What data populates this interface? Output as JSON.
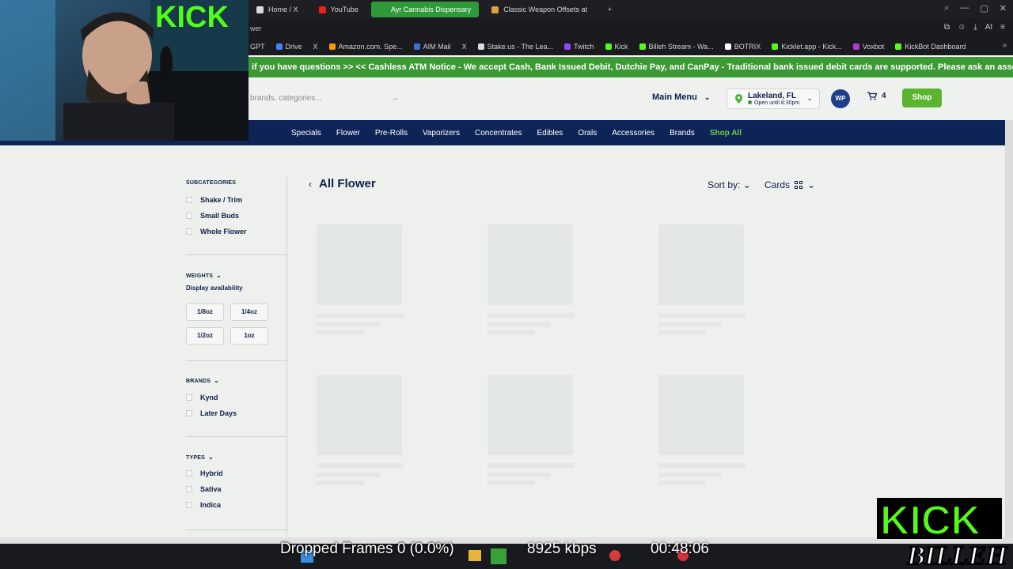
{
  "browser": {
    "tabs": [
      {
        "label": "Home / X",
        "color": "#dcdcdc",
        "active": false
      },
      {
        "label": "YouTube",
        "color": "#e62117",
        "active": false
      },
      {
        "label": "Ayr Cannabis Dispensary",
        "color": "#2f9a3a",
        "active": true
      },
      {
        "label": "Classic Weapon Offsets at",
        "color": "#d9a441",
        "active": false
      }
    ],
    "new_tab": "+",
    "url_fragment": "wer",
    "bookmarks": [
      {
        "label": "GPT",
        "color": ""
      },
      {
        "label": "Drive",
        "color": "#4285f4"
      },
      {
        "label": "X",
        "color": ""
      },
      {
        "label": "Amazon.com. Spe...",
        "color": "#ff9900"
      },
      {
        "label": "AIM Mail",
        "color": "#3a6fd8"
      },
      {
        "label": "X",
        "color": ""
      },
      {
        "label": "Stake.us - The Lea...",
        "color": "#dddddd"
      },
      {
        "label": "Twitch",
        "color": "#9146ff"
      },
      {
        "label": "Kick",
        "color": "#53fc18"
      },
      {
        "label": "Billeh Stream - Wa...",
        "color": "#53fc18"
      },
      {
        "label": "BOTRIX",
        "color": "#ffffff"
      },
      {
        "label": "Kicklet.app - Kick...",
        "color": "#53fc18"
      },
      {
        "label": "Voxbot",
        "color": "#b03bd6"
      },
      {
        "label": "KickBot Dashboard",
        "color": "#53fc18"
      }
    ],
    "toolbar_ai": "AI"
  },
  "site": {
    "ticker": "if you have questions >> << Cashless ATM Notice - We accept Cash, Bank Issued Debit, Dutchie Pay, and CanPay - Traditional bank issued debit cards are supported. Please ask an associate if you have qu",
    "search_placeholder": "brands, categories...",
    "main_menu": "Main Menu",
    "location": {
      "city": "Lakeland, FL",
      "hours": "Open until 8:30pm"
    },
    "avatar": "WP",
    "cart_count": "4",
    "shop_button": "Shop",
    "categories": [
      "Specials",
      "Flower",
      "Pre-Rolls",
      "Vaporizers",
      "Concentrates",
      "Edibles",
      "Orals",
      "Accessories",
      "Brands",
      "Shop All"
    ],
    "highlight_category": "Shop All",
    "colors": {
      "brand_green": "#3c9a35",
      "nav_blue": "#0e2456",
      "shop_green": "#5ab42f"
    }
  },
  "filters": {
    "subcategories_title": "SUBCATEGORIES",
    "subcategories": [
      "Shake / Trim",
      "Small Buds",
      "Whole Flower"
    ],
    "weights_title": "WEIGHTS",
    "display_availability": "Display availability",
    "weights": [
      "1/8oz",
      "1/4oz",
      "1/2oz",
      "1oz"
    ],
    "brands_title": "BRANDS",
    "brands": [
      "Kynd",
      "Later Days"
    ],
    "types_title": "TYPES",
    "types": [
      "Hybrid",
      "Sativa",
      "Indica"
    ]
  },
  "listing": {
    "title": "All Flower",
    "sort_by": "Sort by:",
    "view_mode": "Cards"
  },
  "stream": {
    "dropped_frames": "Dropped Frames 0 (0.0%)",
    "bitrate": "8925 kbps",
    "elapsed": "00:48:06",
    "logo_top": "KICK",
    "logo_bottom": "BILLEH",
    "webcam_sign": "KICK"
  }
}
